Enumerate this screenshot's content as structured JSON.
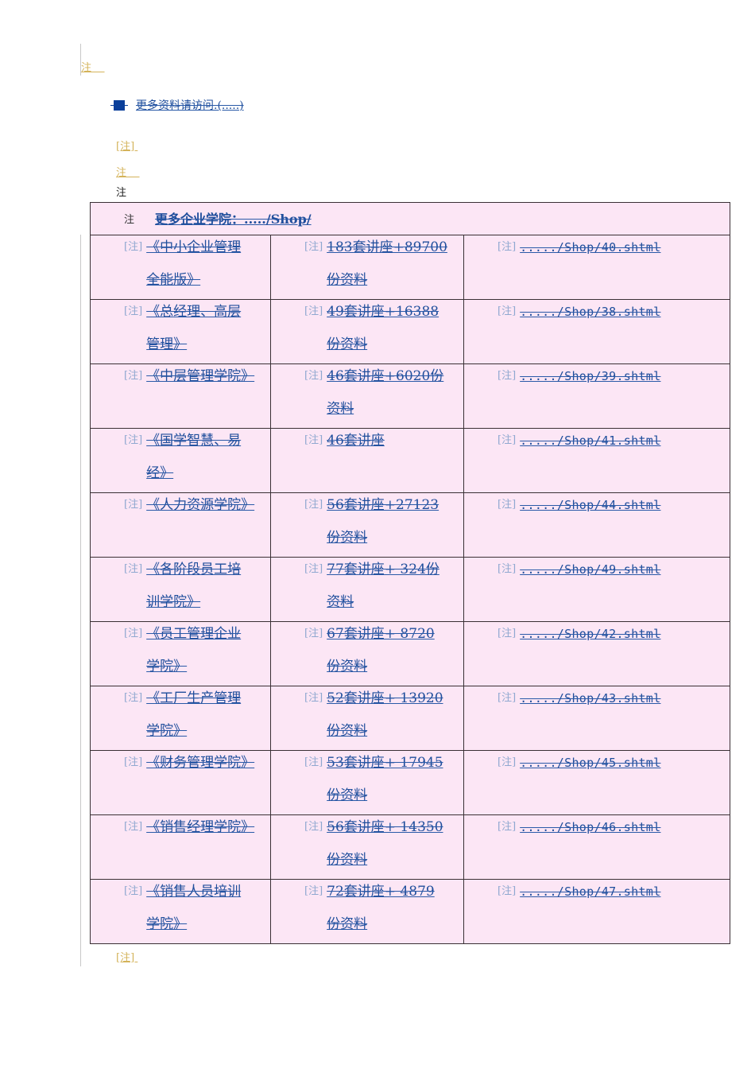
{
  "notes": {
    "top_note": "注    ",
    "bracket_note_1": "[注] ",
    "note_2": "注    ",
    "plain_note": "注",
    "bottom_note": "[注] "
  },
  "bullet": {
    "icon": "square-bullet-icon",
    "link_text": "更多资料请访问.(.....)"
  },
  "table": {
    "header": {
      "note": "注",
      "link_text": "更多企业学院：...../Shop/"
    },
    "cell_note": "[注]",
    "rows": [
      {
        "title": "《中小企业管理全能版》",
        "content": "183套讲座+89700份资料",
        "url": "...../Shop/40.shtml"
      },
      {
        "title": "《总经理、高层管理》",
        "content": "49套讲座+16388份资料",
        "url": "...../Shop/38.shtml"
      },
      {
        "title": "《中层管理学院》",
        "content": "46套讲座+6020份资料",
        "url": "...../Shop/39.shtml"
      },
      {
        "title": "《国学智慧、易经》",
        "content": "46套讲座",
        "url": "...../Shop/41.shtml"
      },
      {
        "title": "《人力资源学院》",
        "content": "56套讲座+27123份资料",
        "url": "...../Shop/44.shtml"
      },
      {
        "title": "《各阶段员工培训学院》",
        "content": "77套讲座+ 324份资料",
        "url": "...../Shop/49.shtml"
      },
      {
        "title": "《员工管理企业学院》",
        "content": "67套讲座+ 8720份资料",
        "url": "...../Shop/42.shtml"
      },
      {
        "title": "《工厂生产管理学院》",
        "content": "52套讲座+ 13920份资料",
        "url": "...../Shop/43.shtml"
      },
      {
        "title": "《财务管理学院》",
        "content": "53套讲座+ 17945份资料",
        "url": "...../Shop/45.shtml"
      },
      {
        "title": "《销售经理学院》",
        "content": "56套讲座+ 14350份资料",
        "url": "...../Shop/46.shtml"
      },
      {
        "title": "《销售人员培训学院》",
        "content": "72套讲座+ 4879份资料",
        "url": "...../Shop/47.shtml"
      }
    ]
  },
  "colors": {
    "table_bg": "#fce6f5",
    "link": "#1f4e9c",
    "note_gold": "#d4b35a",
    "note_blue": "#8fa8d0",
    "bullet": "#0a3f9a"
  }
}
